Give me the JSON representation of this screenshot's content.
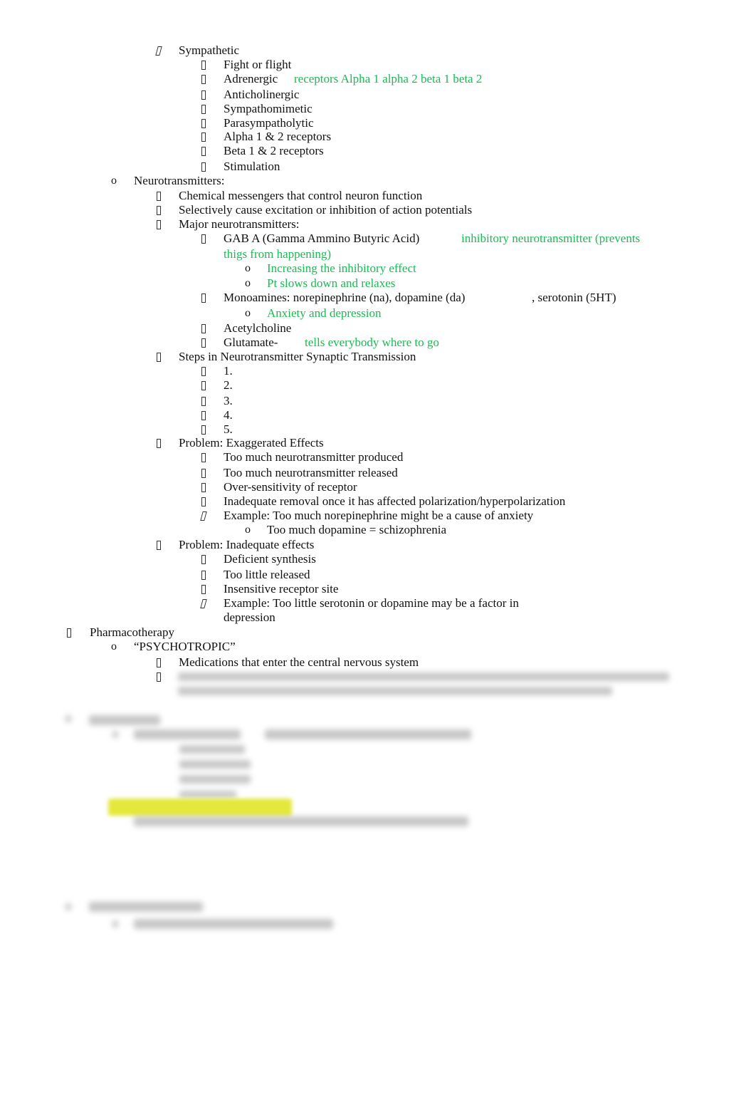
{
  "document": {
    "lines": [
      {
        "level": 2,
        "marker": "italic-box",
        "text": "Sympathetic"
      },
      {
        "level": 3,
        "marker": "box",
        "text": "Fight or flight"
      },
      {
        "level": 3,
        "marker": "box",
        "text": "Adrenergic",
        "note": "receptors Alpha 1 alpha 2 beta 1 beta 2"
      },
      {
        "level": 3,
        "marker": "box",
        "text": "Anticholinergic"
      },
      {
        "level": 3,
        "marker": "box",
        "text": "Sympathomimetic"
      },
      {
        "level": 3,
        "marker": "box",
        "text": "Parasympatholytic"
      },
      {
        "level": 3,
        "marker": "box",
        "text": "Alpha 1 & 2 receptors"
      },
      {
        "level": 3,
        "marker": "box",
        "text": "Beta 1 & 2 receptors"
      },
      {
        "level": 3,
        "marker": "box",
        "text": "Stimulation"
      },
      {
        "level": 1,
        "marker": "o",
        "text": "Neurotransmitters:"
      },
      {
        "level": 2,
        "marker": "box",
        "text": "Chemical messengers that control neuron function"
      },
      {
        "level": 2,
        "marker": "box",
        "text": "Selectively cause excitation or inhibition of action potentials"
      },
      {
        "level": 2,
        "marker": "box",
        "text": "Major neurotransmitters:"
      },
      {
        "level": 3,
        "marker": "box",
        "text": "GAB A (Gamma Ammino Butyric Acid)",
        "note": "inhibitory neurotransmitter (prevents"
      },
      {
        "level": 3,
        "marker": "",
        "text": "",
        "note": "thigs from happening)"
      },
      {
        "level": 4,
        "marker": "o",
        "text": "",
        "note": "Increasing the inhibitory effect"
      },
      {
        "level": 4,
        "marker": "o",
        "text": "",
        "note": "Pt slows down and relaxes"
      },
      {
        "level": 3,
        "marker": "box",
        "text": "Monoamines: norepinephrine (na), dopamine (da)",
        "tail": ", serotonin (5HT)"
      },
      {
        "level": 4,
        "marker": "o",
        "text": "",
        "note": "Anxiety and depression"
      },
      {
        "level": 3,
        "marker": "box",
        "text": "Acetylcholine"
      },
      {
        "level": 3,
        "marker": "box",
        "text": "Glutamate-",
        "note": "tells everybody where to go"
      },
      {
        "level": 2,
        "marker": "box",
        "text": "Steps in Neurotransmitter Synaptic Transmission"
      },
      {
        "level": 3,
        "marker": "box",
        "text": "1."
      },
      {
        "level": 3,
        "marker": "box",
        "text": "2."
      },
      {
        "level": 3,
        "marker": "box",
        "text": "3."
      },
      {
        "level": 3,
        "marker": "box",
        "text": "4."
      },
      {
        "level": 3,
        "marker": "box",
        "text": "5."
      },
      {
        "level": 2,
        "marker": "box",
        "text": "Problem: Exaggerated Effects"
      },
      {
        "level": 3,
        "marker": "box",
        "text": "Too much neurotransmitter produced"
      },
      {
        "level": 3,
        "marker": "box",
        "text": "Too much neurotransmitter released"
      },
      {
        "level": 3,
        "marker": "box",
        "text": "Over-sensitivity of receptor"
      },
      {
        "level": 3,
        "marker": "box",
        "text": "Inadequate removal once it has affected polarization/hyperpolarization"
      },
      {
        "level": 3,
        "marker": "italic-box",
        "text": "Example: Too much norepinephrine might be a cause of anxiety"
      },
      {
        "level": 4,
        "marker": "o",
        "text": "Too much dopamine = schizophrenia"
      },
      {
        "level": 2,
        "marker": "box",
        "text": "Problem: Inadequate effects"
      },
      {
        "level": 3,
        "marker": "box",
        "text": "Deficient synthesis"
      },
      {
        "level": 3,
        "marker": "box",
        "text": "Too little released"
      },
      {
        "level": 3,
        "marker": "box",
        "text": "Insensitive receptor site"
      },
      {
        "level": 3,
        "marker": "italic-box",
        "text": "Example: Too little serotonin or dopamine may be a factor in"
      },
      {
        "level": 3,
        "marker": "",
        "text": "depression"
      },
      {
        "level": 0,
        "marker": "box",
        "text": "Pharmacotherapy"
      },
      {
        "level": 1,
        "marker": "o",
        "text": "“PSYCHOTROPIC”"
      },
      {
        "level": 2,
        "marker": "box",
        "text": "Medications that enter the central nervous system"
      },
      {
        "level": 2,
        "marker": "box",
        "text": ""
      }
    ],
    "colors": {
      "note": "#1db954",
      "text": "#111111",
      "highlight": "#e4e83a"
    }
  }
}
